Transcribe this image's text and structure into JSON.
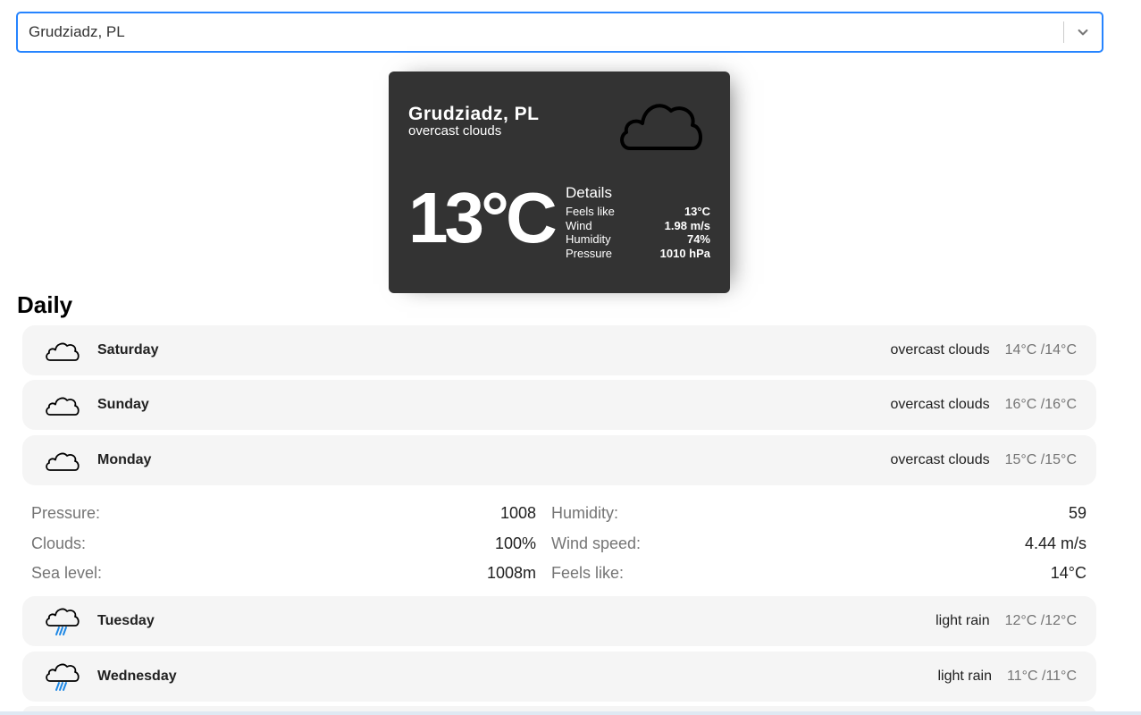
{
  "search": {
    "value": "Grudziadz, PL",
    "icon": "chevron-down-icon"
  },
  "current": {
    "city": "Grudziadz, PL",
    "description": "overcast clouds",
    "icon": "cloud-icon",
    "temperature": "13°C",
    "details_title": "Details",
    "details": [
      {
        "label": "Feels like",
        "value": "13°C"
      },
      {
        "label": "Wind",
        "value": "1.98 m/s"
      },
      {
        "label": "Humidity",
        "value": "74%"
      },
      {
        "label": "Pressure",
        "value": "1010 hPa"
      }
    ]
  },
  "daily": {
    "heading": "Daily",
    "days": [
      {
        "name": "Saturday",
        "description": "overcast clouds",
        "temps": "14°C /14°C",
        "icon": "cloud-icon"
      },
      {
        "name": "Sunday",
        "description": "overcast clouds",
        "temps": "16°C /16°C",
        "icon": "cloud-icon"
      },
      {
        "name": "Monday",
        "description": "overcast clouds",
        "temps": "15°C /15°C",
        "icon": "cloud-icon"
      },
      {
        "name": "Tuesday",
        "description": "light rain",
        "temps": "12°C /12°C",
        "icon": "rain-cloud-icon"
      },
      {
        "name": "Wednesday",
        "description": "light rain",
        "temps": "11°C /11°C",
        "icon": "rain-cloud-icon"
      }
    ],
    "expanded": [
      {
        "label": "Pressure:",
        "value": "1008"
      },
      {
        "label": "Humidity:",
        "value": "59"
      },
      {
        "label": "Clouds:",
        "value": "100%"
      },
      {
        "label": "Wind speed:",
        "value": "4.44 m/s"
      },
      {
        "label": "Sea level:",
        "value": "1008m"
      },
      {
        "label": "Feels like:",
        "value": "14°C"
      }
    ]
  },
  "colors": {
    "accent": "#2684ff",
    "card_bg": "#333333",
    "row_bg": "#f5f5f5",
    "rain": "#1e88e5"
  }
}
